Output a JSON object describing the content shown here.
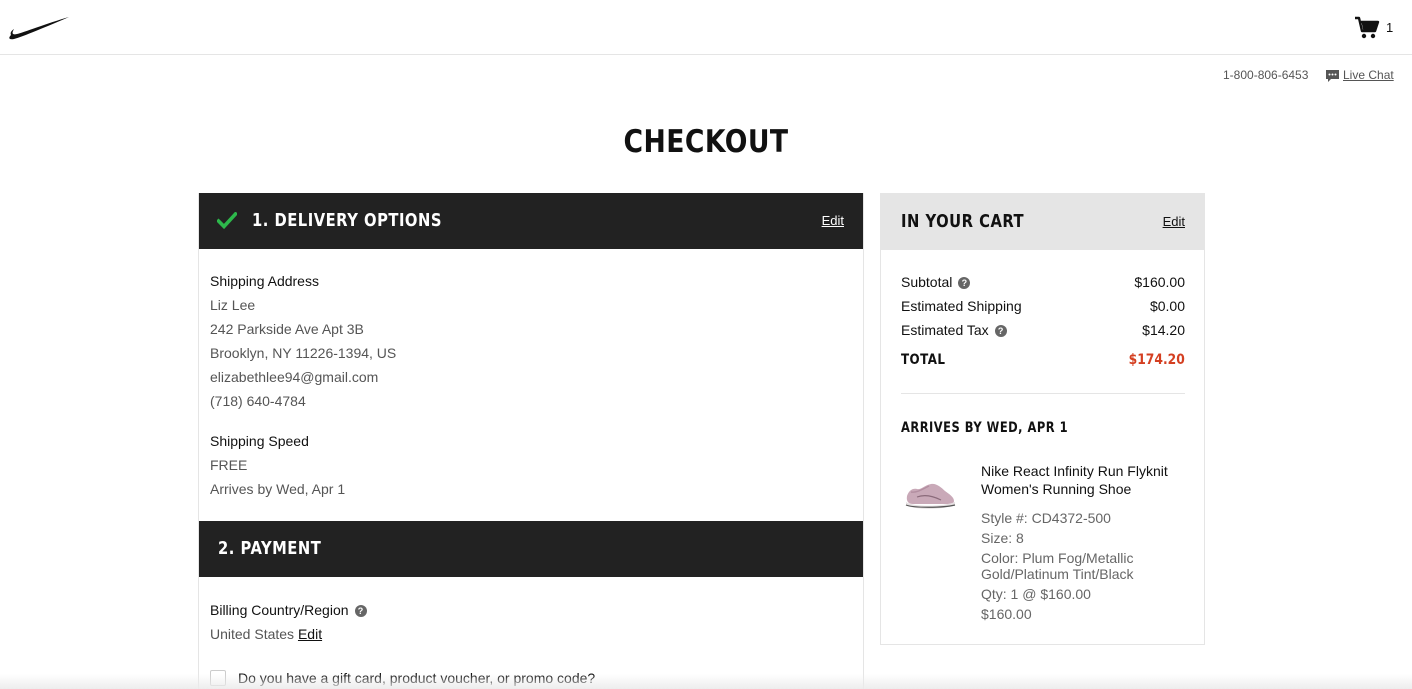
{
  "header": {
    "brand": "Nike",
    "cart_count": "1"
  },
  "support": {
    "phone": "1-800-806-6453",
    "live_chat": "Live Chat"
  },
  "page_title": "CHECKOUT",
  "delivery": {
    "heading": "1. DELIVERY OPTIONS",
    "edit": "Edit",
    "shipping_address_label": "Shipping Address",
    "name": "Liz Lee",
    "street": "242 Parkside Ave Apt 3B",
    "city_state": "Brooklyn, NY 11226-1394, US",
    "email": "elizabethlee94@gmail.com",
    "phone": "(718) 640-4784",
    "shipping_speed_label": "Shipping Speed",
    "speed": "FREE",
    "arrives": "Arrives by Wed, Apr 1"
  },
  "payment": {
    "heading": "2. PAYMENT",
    "billing_label": "Billing Country/Region",
    "billing_value": "United States",
    "billing_edit": "Edit",
    "gift_label": "Do you have a gift card, product voucher, or promo code?"
  },
  "cart": {
    "heading": "IN YOUR CART",
    "edit": "Edit",
    "subtotal_label": "Subtotal",
    "subtotal": "$160.00",
    "shipping_label": "Estimated Shipping",
    "shipping": "$0.00",
    "tax_label": "Estimated Tax",
    "tax": "$14.20",
    "total_label": "TOTAL",
    "total": "$174.20",
    "arrives_heading": "ARRIVES BY WED, APR 1",
    "product": {
      "name": "Nike React Infinity Run Flyknit Women's Running Shoe",
      "style": "Style #: CD4372-500",
      "size": "Size: 8",
      "color": "Color: Plum Fog/Metallic Gold/Platinum Tint/Black",
      "qty": "Qty: 1 @ $160.00",
      "price": "$160.00"
    }
  },
  "colors": {
    "header_dark": "#222222",
    "total_red": "#d43f21",
    "check_green": "#2db84b"
  }
}
